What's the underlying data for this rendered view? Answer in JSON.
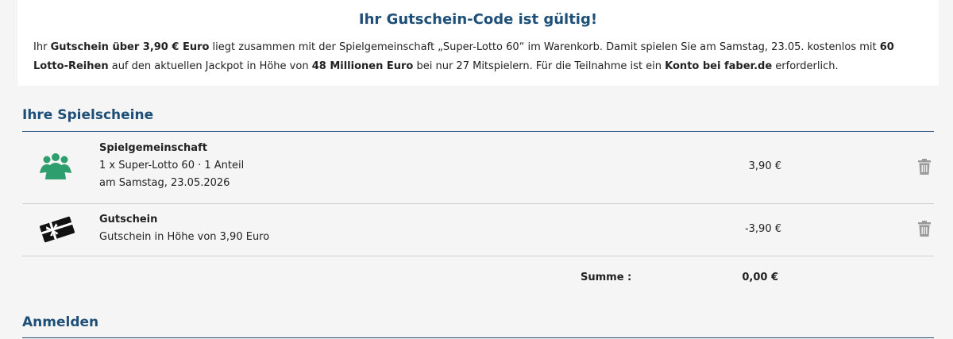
{
  "notice": {
    "title": "Ihr Gutschein-Code ist gültig!",
    "p1": "Ihr ",
    "p2": "Gutschein über 3,90 € Euro",
    "p3": " liegt zusammen mit der Spielgemeinschaft „Super-Lotto 60“ im Warenkorb. Damit spielen Sie am Samstag, 23.05. kostenlos mit ",
    "p4": "60 Lotto-Reihen",
    "p5": " auf den aktuellen Jackpot in Höhe von ",
    "p6": "48 Millionen Euro",
    "p7": " bei nur 27 Mitspielern. Für die Teilnahme ist ein ",
    "p8": "Konto bei faber.de",
    "p9": " erforderlich."
  },
  "cart": {
    "title": "Ihre Spielscheine",
    "items": [
      {
        "icon": "group-icon",
        "title": "Spielgemeinschaft",
        "line1": "1 x Super-Lotto 60 · 1 Anteil",
        "line2": "am Samstag, 23.05.2026",
        "price": "3,90 €"
      },
      {
        "icon": "gift-card-icon",
        "title": "Gutschein",
        "line1": "Gutschein in Höhe von 3,90 Euro",
        "price": "-3,90 €"
      }
    ],
    "sum_label": "Summe :",
    "sum_value": "0,00 €"
  },
  "login": {
    "title": "Anmelden"
  },
  "colors": {
    "accent": "#1d4f78",
    "group_icon": "#2f9e6e",
    "trash": "#9a9a9a"
  }
}
